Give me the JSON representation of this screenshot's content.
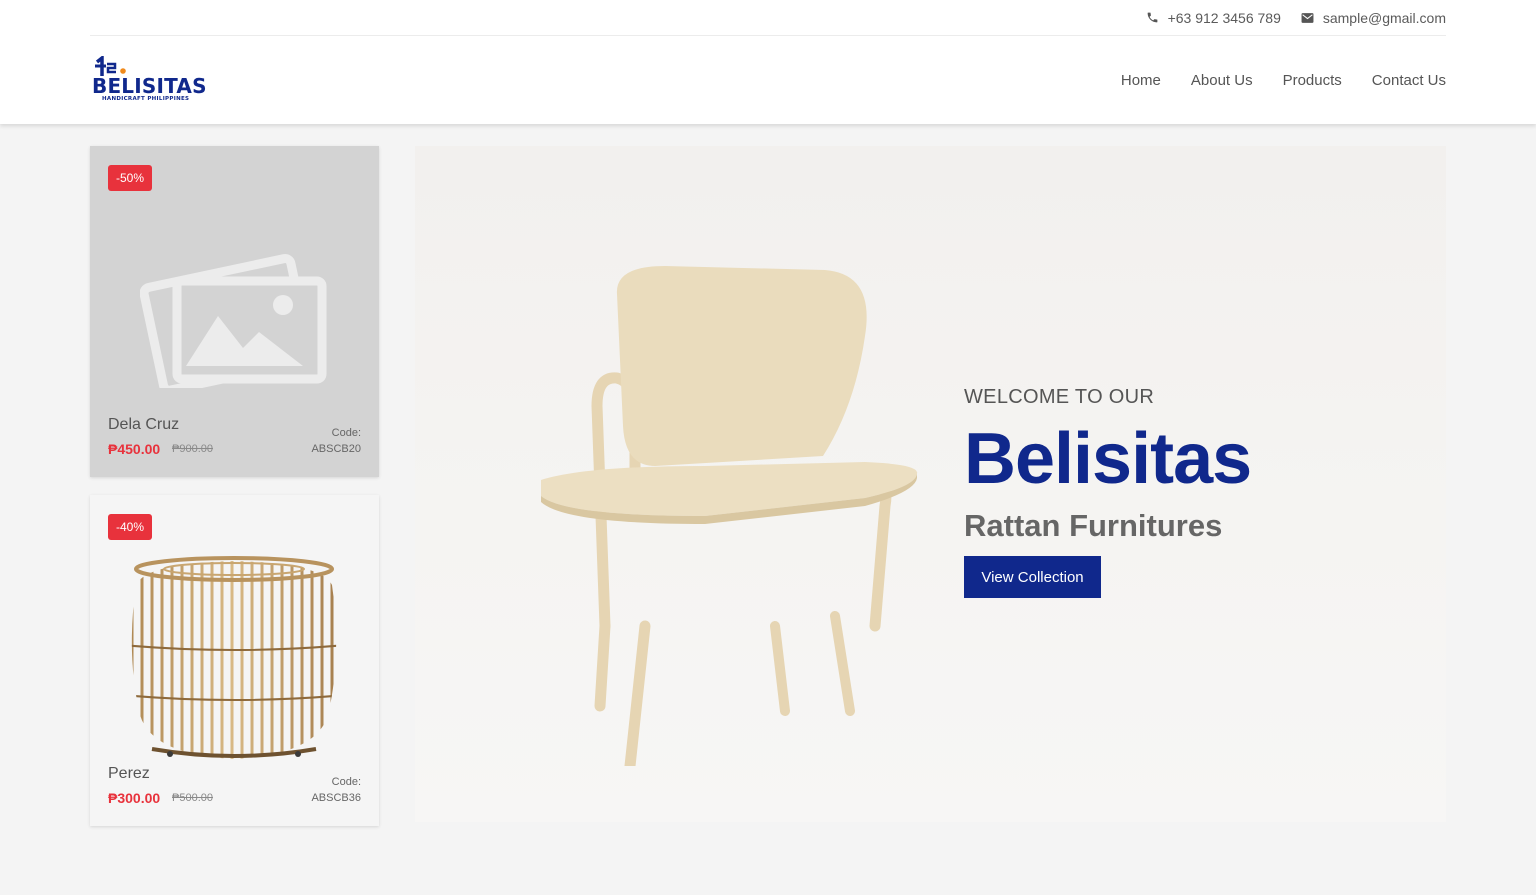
{
  "topbar": {
    "phone": "+63 912 3456 789",
    "email": "sample@gmail.com",
    "phone_icon": "phone-icon",
    "email_icon": "envelope-icon"
  },
  "brand": {
    "name": "BELISITAS",
    "tagline": "HANDICRAFT PHILIPPINES",
    "color": "#10288c"
  },
  "nav": {
    "items": [
      {
        "label": "Home"
      },
      {
        "label": "About Us"
      },
      {
        "label": "Products"
      },
      {
        "label": "Contact Us"
      }
    ]
  },
  "products": [
    {
      "discount": "-50%",
      "name": "Dela Cruz",
      "price": "₱450.00",
      "old_price": "₱900.00",
      "code_label": "Code:",
      "code": "ABSCB20",
      "image": "image-placeholder-icon"
    },
    {
      "discount": "-40%",
      "name": "Perez",
      "price": "₱300.00",
      "old_price": "₱500.00",
      "code_label": "Code:",
      "code": "ABSCB36",
      "image": "rattan-stool"
    }
  ],
  "hero": {
    "welcome": "WELCOME TO OUR",
    "title": "Belisitas",
    "subtitle": "Rattan Furnitures",
    "button": "View Collection",
    "image": "wooden-chair"
  },
  "colors": {
    "accent": "#10288c",
    "sale": "#e8323c"
  }
}
